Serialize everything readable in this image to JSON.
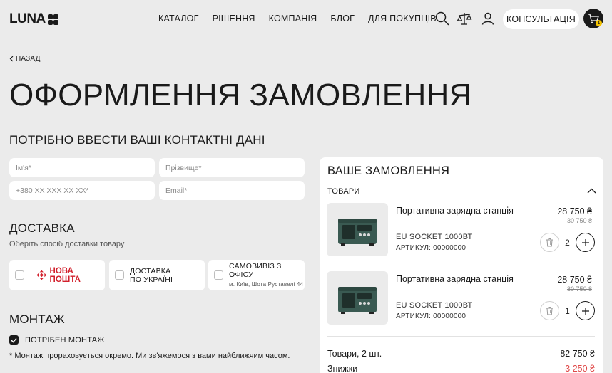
{
  "header": {
    "logo": "LUNA",
    "nav": [
      "КАТАЛОГ",
      "РІШЕННЯ",
      "КОМПАНІЯ",
      "БЛОГ",
      "ДЛЯ ПОКУПЦІВ"
    ],
    "consult_label": "КОНСУЛЬТАЦІЯ",
    "cart_count": "1"
  },
  "back_label": "НАЗАД",
  "page_title": "ОФОРМЛЕННЯ ЗАМОВЛЕННЯ",
  "contacts": {
    "title": "ПОТРІБНО ВВЕСТИ ВАШІ КОНТАКТНІ ДАНІ",
    "first_name_placeholder": "Ім'я*",
    "last_name_placeholder": "Прізвище*",
    "phone_placeholder": "+380 XX XXX XX XX*",
    "email_placeholder": "Email*"
  },
  "delivery": {
    "title": "ДОСТАВКА",
    "subtitle": "Оберіть спосіб доставки товару",
    "options": [
      {
        "label": "НОВА ПОШТА",
        "note": ""
      },
      {
        "label_line1": "ДОСТАВКА",
        "label_line2": "ПО УКРАЇНІ"
      },
      {
        "label": "САМОВИВІЗ З ОФІСУ",
        "note": "м. Київ, Шота Руставелі 44"
      }
    ]
  },
  "mounting": {
    "title": "МОНТАЖ",
    "checkbox_label": "ПОТРІБЕН МОНТАЖ",
    "checked": true,
    "note": "* Монтаж прораховується окремо. Ми зв'яжемося з вами найближчим часом."
  },
  "order": {
    "title": "ВАШЕ ЗАМОВЛЕННЯ",
    "goods_label": "ТОВАРИ",
    "items": [
      {
        "name": "Портативна зарядна станція",
        "variant": "EU SOCKET 1000ВТ",
        "sku": "АРТИКУЛ: 00000000",
        "price": "28 750 ₴",
        "old_price": "30 750 ₴",
        "qty": "2"
      },
      {
        "name": "Портативна зарядна станція",
        "variant": "EU SOCKET 1000ВТ",
        "sku": "АРТИКУЛ: 00000000",
        "price": "28 750 ₴",
        "old_price": "30 750 ₴",
        "qty": "1"
      }
    ],
    "summary": {
      "goods_label": "Товари, 2 шт.",
      "goods_value": "82 750 ₴",
      "discount_label": "Знижки",
      "discount_value": "-3 250 ₴"
    }
  },
  "colors": {
    "background": "#ebebeb",
    "accent_dark": "#1a1a1a",
    "badge": "#f5c400",
    "nova_poshta": "#d2202c",
    "discount": "#e04848"
  }
}
